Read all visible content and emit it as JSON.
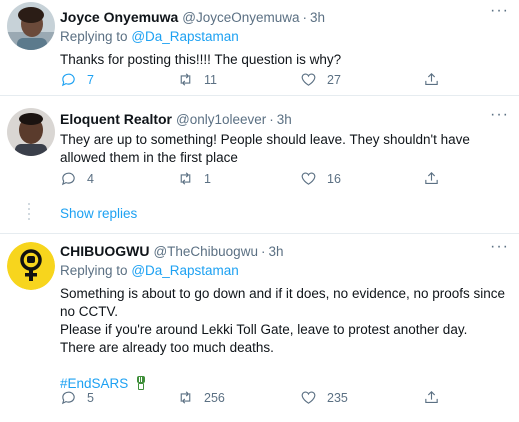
{
  "tweets": [
    {
      "name": "Joyce Onyemuwa",
      "handle": "@JoyceOnyemuwa",
      "time": "3h",
      "replying_prefix": "Replying to",
      "replying_to": "@Da_Rapstaman",
      "text": "Thanks for posting this!!!! The question is why?",
      "replies": "7",
      "retweets": "11",
      "likes": "27"
    },
    {
      "name": "Eloquent Realtor",
      "handle": "@only1oleever",
      "time": "3h",
      "text": "They are up to something!  People should leave.  They shouldn't have allowed them in the first place",
      "replies": "4",
      "retweets": "1",
      "likes": "16"
    },
    {
      "name": "CHIBUOGWU",
      "handle": "@TheChibuogwu",
      "time": "3h",
      "replying_prefix": "Replying to",
      "replying_to": "@Da_Rapstaman",
      "lines": [
        "Something is about to go down and if it does, no evidence, no proofs since no CCTV.",
        "Please if you're around Lekki Toll Gate, leave to protest another day.",
        "There are already too much deaths."
      ],
      "hashtag": "#EndSARS",
      "replies": "5",
      "retweets": "256",
      "likes": "235"
    }
  ],
  "show_replies": "Show replies",
  "colors": {
    "accent": "#1da1f2",
    "secondary_text": "#5b7083",
    "divider": "#e6ecf0"
  },
  "icons": [
    "more-icon",
    "reply-icon",
    "retweet-icon",
    "like-icon",
    "share-icon",
    "venus-fist-icon",
    "fist-emoji-icon"
  ]
}
